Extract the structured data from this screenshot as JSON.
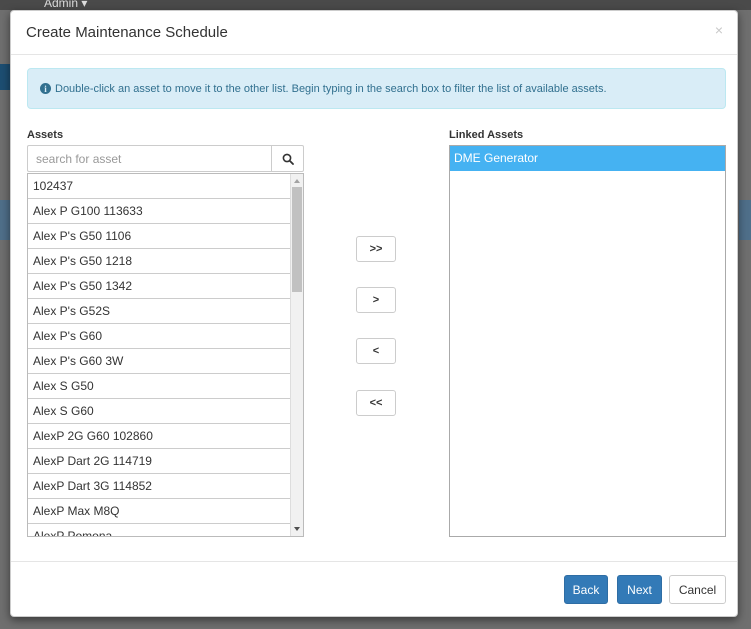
{
  "background": {
    "user_menu": "Admin ▾"
  },
  "modal": {
    "title": "Create Maintenance Schedule",
    "close_label": "×",
    "info_message": "Double-click an asset to move it to the other list. Begin typing in the search box to filter the list of available assets.",
    "assets_label": "Assets",
    "linked_label": "Linked Assets",
    "search": {
      "placeholder": "search for asset",
      "value": ""
    },
    "assets": [
      "102437",
      "Alex P G100 113633",
      "Alex P's G50 1106",
      "Alex P's G50 1218",
      "Alex P's G50 1342",
      "Alex P's G52S",
      "Alex P's G60",
      "Alex P's G60 3W",
      "Alex S G50",
      "Alex S G60",
      "AlexP 2G G60 102860",
      "AlexP Dart 2G 114719",
      "AlexP Dart 3G 114852",
      "AlexP Max M8Q",
      "AlexP Pomona"
    ],
    "linked_assets": [
      "DME Generator"
    ],
    "move_buttons": {
      "move_all_right": ">>",
      "move_right": ">",
      "move_left": "<",
      "move_all_left": "<<"
    },
    "footer": {
      "back": "Back",
      "next": "Next",
      "cancel": "Cancel"
    }
  },
  "colors": {
    "primary": "#337ab7",
    "selected": "#45b2f2",
    "info_bg": "#d9edf7",
    "info_text": "#31708f"
  },
  "icons": {
    "search": "search-icon",
    "info": "info-circle-icon",
    "close": "close-icon"
  }
}
